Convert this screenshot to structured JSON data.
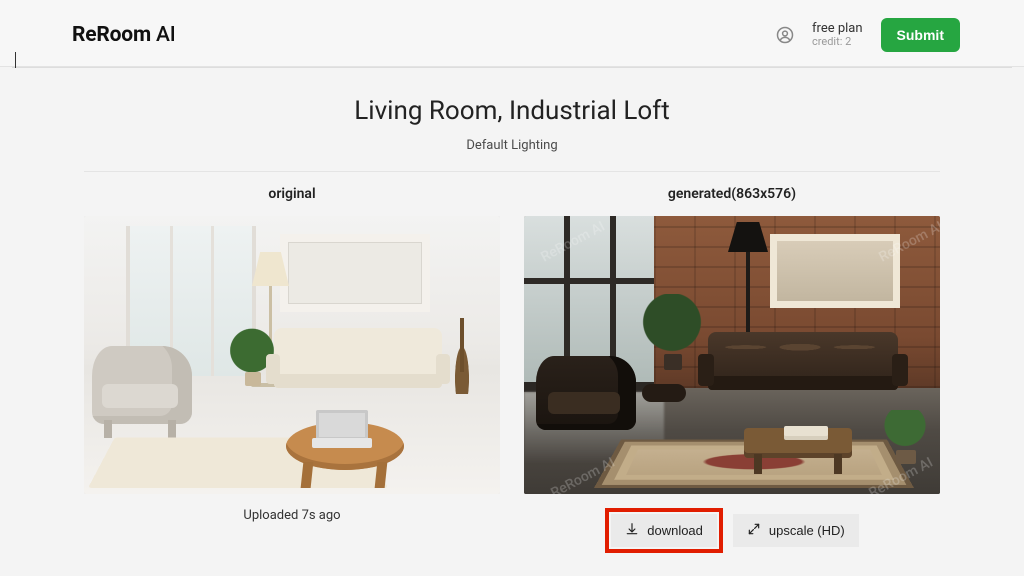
{
  "header": {
    "logo_main": "ReRoom",
    "logo_suffix": " AI",
    "plan_name": "free plan",
    "credit_label": "credit: 2",
    "submit_label": "Submit"
  },
  "page": {
    "title": "Living Room, Industrial Loft",
    "subtitle": "Default Lighting"
  },
  "columns": {
    "original": {
      "label": "original",
      "caption": "Uploaded 7s ago"
    },
    "generated": {
      "label": "generated(863x576)",
      "download_label": "download",
      "upscale_label": "upscale (HD)"
    }
  },
  "watermark_text": "ReRoom AI"
}
